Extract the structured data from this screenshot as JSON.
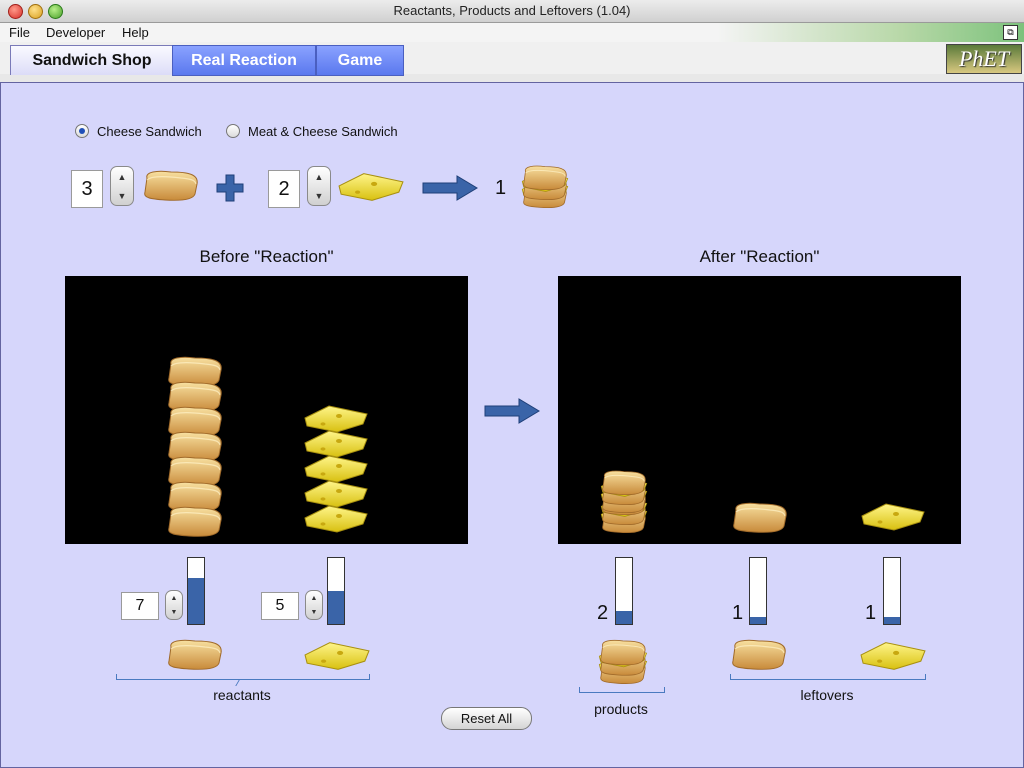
{
  "window": {
    "title": "Reactants, Products and Leftovers (1.04)"
  },
  "menu": {
    "items": [
      "File",
      "Developer",
      "Help"
    ]
  },
  "tabs": [
    {
      "label": "Sandwich Shop",
      "active": true
    },
    {
      "label": "Real Reaction",
      "active": false
    },
    {
      "label": "Game",
      "active": false
    }
  ],
  "logo": {
    "text": "PhET"
  },
  "sandwich_choice": {
    "options": [
      "Cheese Sandwich",
      "Meat & Cheese Sandwich"
    ],
    "selected": "Cheese Sandwich"
  },
  "recipe": {
    "bread_count": "3",
    "cheese_count": "2",
    "product_count": "1"
  },
  "before": {
    "heading": "Before \"Reaction\"",
    "bread_quantity": "7",
    "cheese_quantity": "5",
    "bread_fill": 0.7,
    "cheese_fill": 0.5,
    "group_label": "reactants"
  },
  "after": {
    "heading": "After \"Reaction\"",
    "sandwich_count": "2",
    "bread_leftover": "1",
    "cheese_leftover": "1",
    "sandwich_fill": 0.2,
    "bread_fill": 0.1,
    "cheese_fill": 0.1,
    "products_label": "products",
    "leftovers_label": "leftovers"
  },
  "buttons": {
    "reset_all": "Reset All"
  },
  "colors": {
    "panel_bg": "#d6d6fb",
    "arrow_blue": "#3a64a8",
    "bread": "#e8b860",
    "cheese": "#f2e23a",
    "bar_fill": "#3a64a8"
  }
}
